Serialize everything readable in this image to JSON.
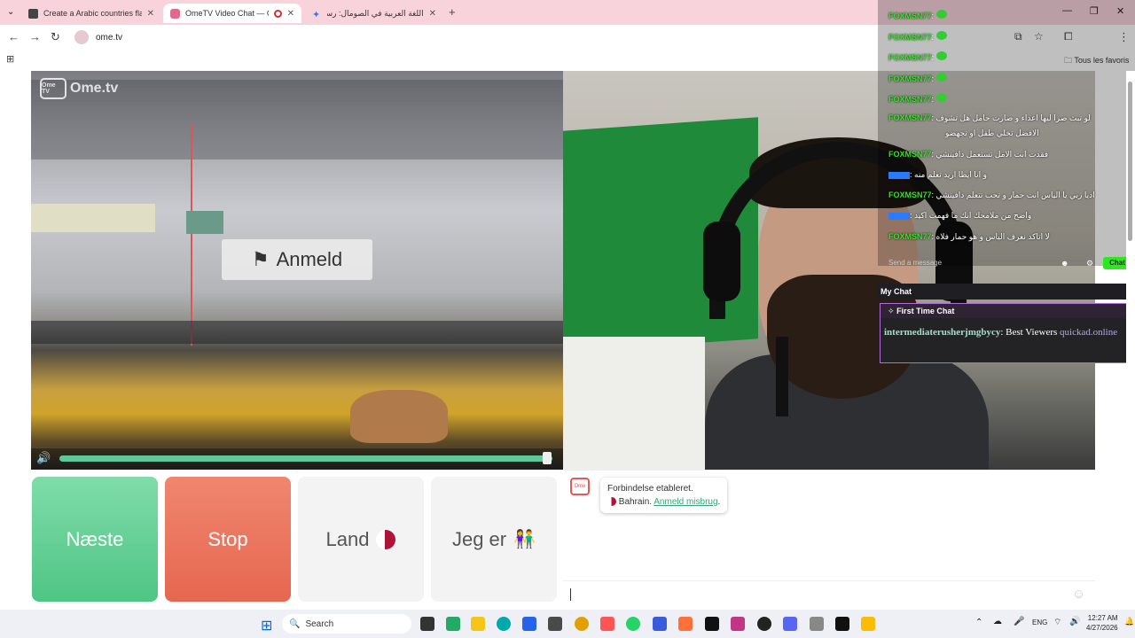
{
  "browser": {
    "tabs": [
      {
        "title": "Create a Arabic countries flags",
        "active": false
      },
      {
        "title": "OmeTV Video Chat — Ome",
        "active": true
      },
      {
        "title": "اللغة العربية في الصومال: رسمية",
        "active": false
      }
    ],
    "url": "ome.tv",
    "bookmarks_label": "Tous les favoris"
  },
  "video": {
    "logo": "Ome.tv",
    "logo_badge": "Ome TV",
    "report_button": "Anmeld",
    "volume_level": 0.99
  },
  "controls": {
    "next": "Næste",
    "stop": "Stop",
    "country": "Land",
    "i_am": "Jeg er"
  },
  "chat": {
    "status": "Forbindelse etableret.",
    "country": "Bahrain.",
    "report_link": "Anmeld misbrug",
    "report_link_suffix": "."
  },
  "overlay": {
    "lines": [
      {
        "user": "FOXMSN77",
        "text": ""
      },
      {
        "user": "FOXMSN77",
        "text": ""
      },
      {
        "user": "FOXMSN77",
        "text": ""
      },
      {
        "user": "FOXMSN77",
        "text": ""
      },
      {
        "user": "FOXMSN77",
        "text": ""
      },
      {
        "user": "FOXMSN77",
        "text": "لو تبث صرا ليها اعداء و صارت حامل هل تشوف"
      },
      {
        "user": "",
        "text": "الافضل تخلي طفل او تجهضو"
      },
      {
        "user": "FOXMSN77",
        "text": "فقدت انت الامل تستعمل دافينشي"
      },
      {
        "user": "",
        "text": "و انا ايظا اريد تعلم منه"
      },
      {
        "user": "FOXMSN77",
        "text": "اديا زبي يا الياس انت حمار و تحب تتعلم دافينشي"
      },
      {
        "user": "",
        "text": "واضح من ملامحك انك ما فهمت اكيد"
      },
      {
        "user": "FOXMSN77",
        "text": "لا اتاكد نعرف الياس و هو حمار فلاه"
      }
    ],
    "send_placeholder": "Send a message",
    "chat_button": "Chat",
    "my_chat": "My Chat",
    "first_time_chat": "First Time Chat",
    "ftc_user": "intermediaterusherjmgbycy",
    "ftc_text": ": Best Viewers ",
    "ftc_link": "quickad.online"
  },
  "taskbar": {
    "search": "Search",
    "lang": "ENG",
    "time": "12:27 AM",
    "date": "4/27/2026"
  }
}
